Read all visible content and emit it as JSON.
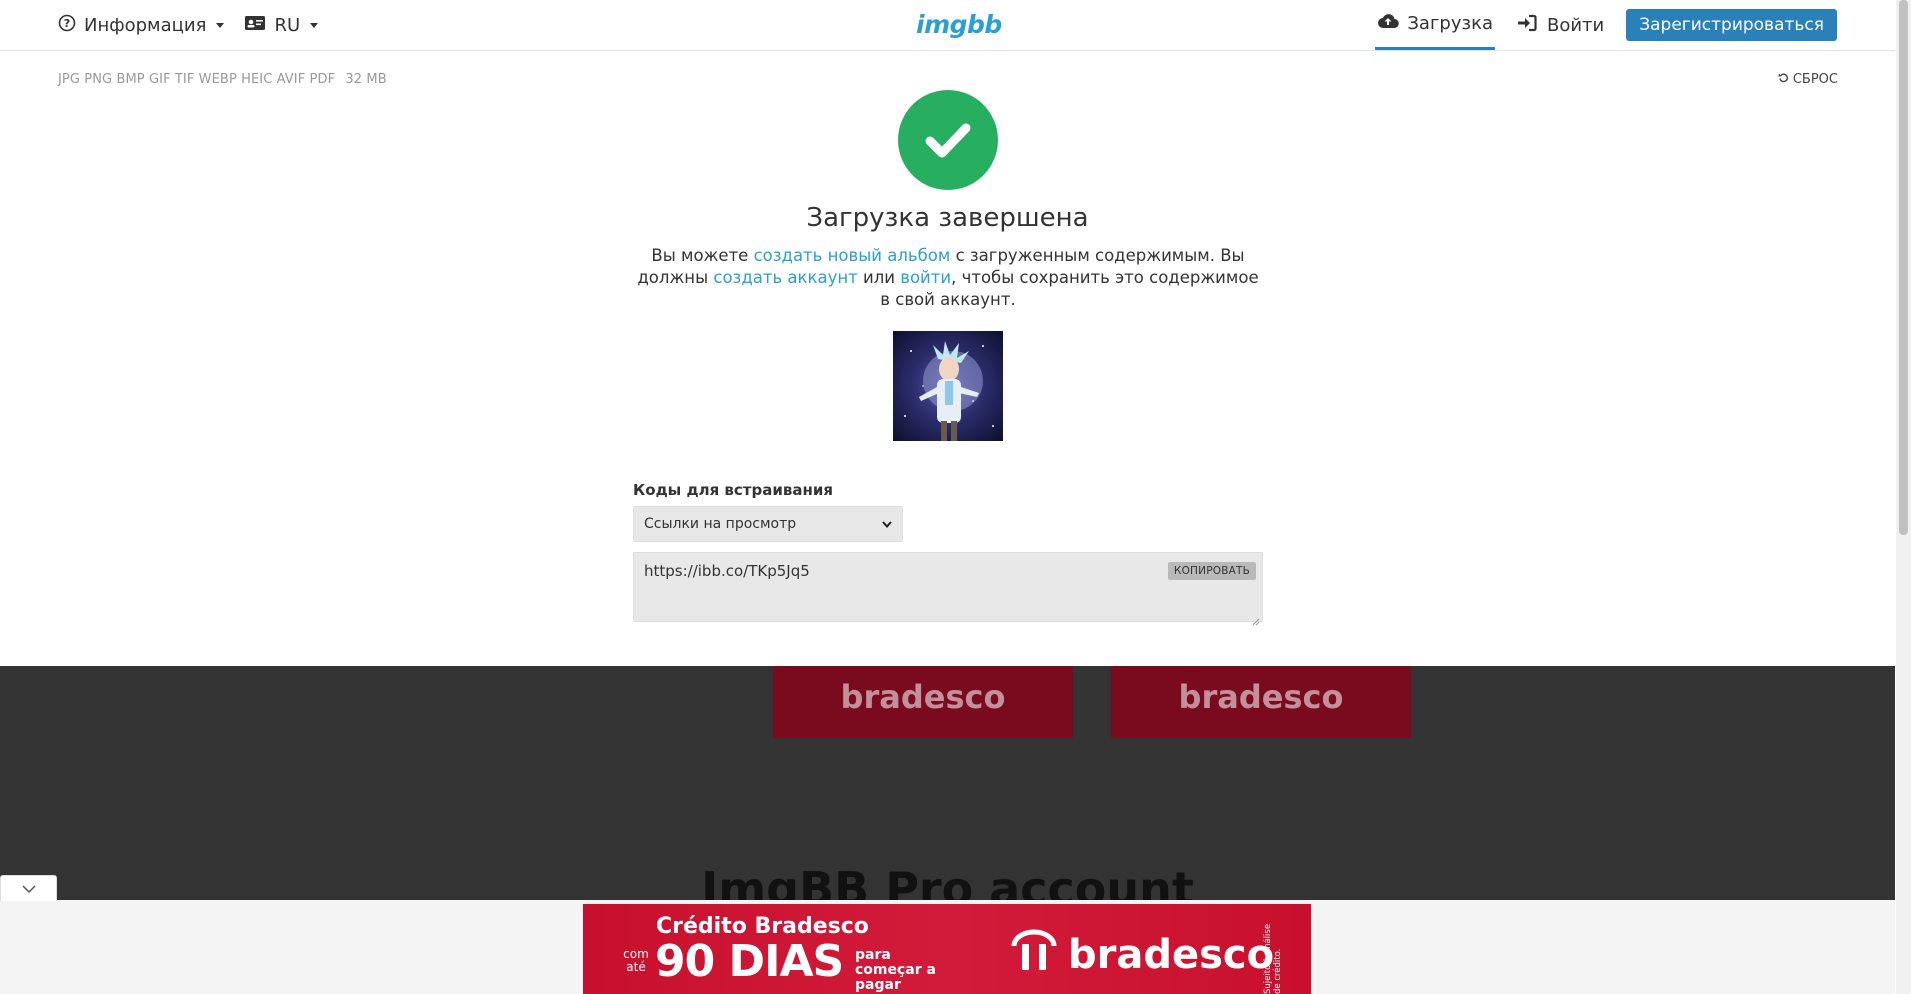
{
  "header": {
    "info_label": "Информация",
    "lang_label": "RU",
    "logo_text": "imgbb",
    "upload_label": "Загрузка",
    "login_label": "Войти",
    "register_label": "Зарегистрироваться"
  },
  "upload_info": {
    "file_types": "JPG PNG BMP GIF TIF WEBP HEIC AVIF PDF",
    "max_size": "32 MB",
    "reset_label": "СБРОС"
  },
  "result": {
    "title": "Загрузка завершена",
    "desc_part1": "Вы можете ",
    "link_album": "создать новый альбом",
    "desc_part2": " с загруженным содержимым. Вы должны ",
    "link_account": "создать аккаунт",
    "desc_part3": " или ",
    "link_login": "войти",
    "desc_part4": ", чтобы сохранить это содержимое в свой аккаунт."
  },
  "embed": {
    "label": "Коды для встраивания",
    "selected": "Ссылки на просмотр",
    "code_value": "https://ibb.co/TKp5Jq5",
    "copy_label": "КОПИРОВАТЬ"
  },
  "dark_section": {
    "ad_text_1": "bradesco",
    "ad_text_2": "bradesco",
    "pro_title": "ImgBB Pro account"
  },
  "banner": {
    "title": "Crédito Bradesco",
    "com_ate": "com até",
    "big": "90 DIAS",
    "small": "para começar a pagar",
    "brand": "bradesco",
    "disclaimer": "Sujeito à análise de crédito."
  },
  "colors": {
    "accent": "#2a80b9",
    "link": "#2a9fd6",
    "success": "#27ae60",
    "dark_bg": "#333333",
    "banner_red": "#c8102e"
  }
}
